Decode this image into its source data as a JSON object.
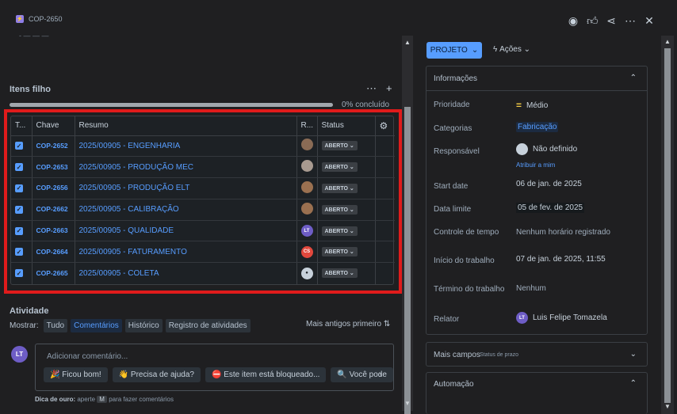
{
  "header": {
    "issue_key": "COP-2650",
    "actions": [
      "eye-icon",
      "thumbs-up-icon",
      "share-icon",
      "more-icon",
      "close-icon"
    ]
  },
  "child_items": {
    "title": "Itens filho",
    "progress_text": "0% concluído",
    "progress_value": 0,
    "columns": [
      "T...",
      "Chave",
      "Resumo",
      "R...",
      "Status"
    ],
    "rows": [
      {
        "key": "COP-2652",
        "summary": "2025/00905 - ENGENHARIA",
        "assignee": "photo",
        "status": "ABERTO"
      },
      {
        "key": "COP-2653",
        "summary": "2025/00905 - PRODUÇÃO MEC",
        "assignee": "photo",
        "status": "ABERTO"
      },
      {
        "key": "COP-2656",
        "summary": "2025/00905 - PRODUÇÃO ELT",
        "assignee": "photo",
        "status": "ABERTO"
      },
      {
        "key": "COP-2662",
        "summary": "2025/00905 - CALIBRAÇÃO",
        "assignee": "photo",
        "status": "ABERTO"
      },
      {
        "key": "COP-2663",
        "summary": "2025/00905 - QUALIDADE",
        "assignee": "LT",
        "status": "ABERTO"
      },
      {
        "key": "COP-2664",
        "summary": "2025/00905 - FATURAMENTO",
        "assignee": "CS",
        "status": "ABERTO"
      },
      {
        "key": "COP-2665",
        "summary": "2025/00905 - COLETA",
        "assignee": "none",
        "status": "ABERTO"
      }
    ]
  },
  "activity": {
    "title": "Atividade",
    "show_label": "Mostrar:",
    "filters": [
      "Tudo",
      "Comentários",
      "Histórico",
      "Registro de atividades"
    ],
    "active_filter": "Comentários",
    "order_label": "Mais antigos primeiro",
    "user_initials": "LT",
    "comment_placeholder": "Adicionar comentário...",
    "quick_replies": [
      "🎉 Ficou bom!",
      "👋 Precisa de ajuda?",
      "⛔ Este item está bloqueado...",
      "🔍 Você pode"
    ],
    "tip_bold": "Dica de ouro:",
    "tip_pre": "aperte",
    "tip_key": "M",
    "tip_post": "para fazer comentários"
  },
  "side": {
    "project_button": "PROJETO",
    "actions_label": "Ações",
    "info_title": "Informações",
    "fields": {
      "priority_label": "Prioridade",
      "priority_value": "Médio",
      "categories_label": "Categorias",
      "categories_value": "Fabricação",
      "responsible_label": "Responsável",
      "responsible_value": "Não definido",
      "assign_to_me": "Atribuir a mim",
      "start_date_label": "Start date",
      "start_date_value": "06 de jan. de 2025",
      "due_date_label": "Data limite",
      "due_date_value": "05 de fev. de 2025",
      "time_control_label": "Controle de tempo",
      "time_control_value": "Nenhum horário registrado",
      "work_start_label": "Início do trabalho",
      "work_start_value": "07 de jan. de 2025, 11:55",
      "work_end_label": "Término do trabalho",
      "work_end_value": "Nenhum",
      "reporter_label": "Relator",
      "reporter_initials": "LT",
      "reporter_value": "Luis Felipe Tomazela"
    },
    "more_fields": "Mais campos",
    "more_fields_sub": "Status de prazo",
    "automation": "Automação"
  }
}
